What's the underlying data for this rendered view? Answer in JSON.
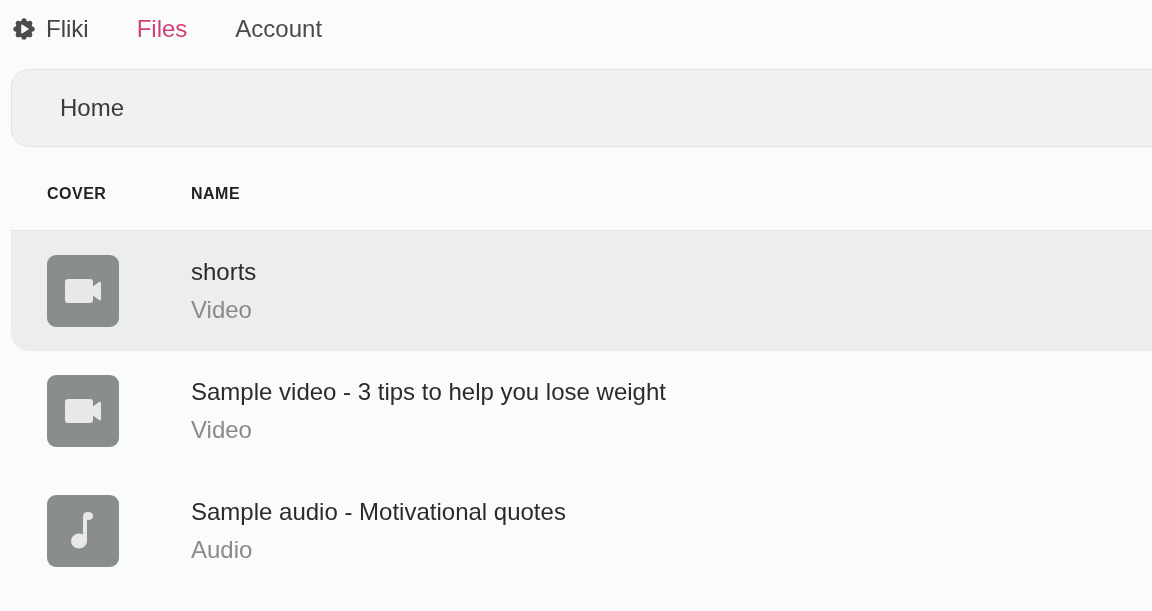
{
  "nav": {
    "brand": "Fliki",
    "tabs": [
      {
        "label": "Files",
        "selected": true
      },
      {
        "label": "Account",
        "selected": false
      }
    ]
  },
  "breadcrumb": [
    "Home"
  ],
  "table": {
    "columns": [
      "COVER",
      "NAME"
    ],
    "rows": [
      {
        "kind": "video",
        "title": "shorts",
        "subtitle": "Video",
        "selected": true
      },
      {
        "kind": "video",
        "title": "Sample video - 3 tips to help you lose weight",
        "subtitle": "Video",
        "selected": false
      },
      {
        "kind": "audio",
        "title": "Sample audio - Motivational quotes",
        "subtitle": "Audio",
        "selected": false
      }
    ]
  }
}
